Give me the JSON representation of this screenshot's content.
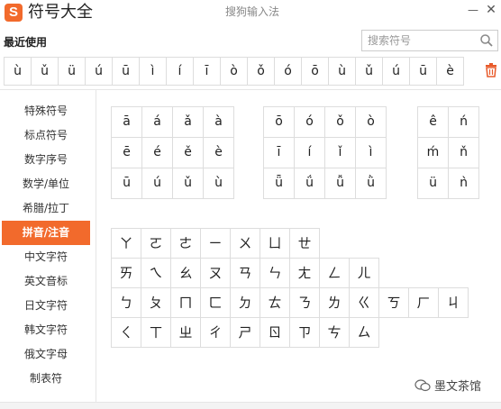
{
  "app": {
    "logo_letter": "S",
    "title": "符号大全",
    "window_title": "搜狗输入法",
    "minimize_glyph": "—",
    "close_glyph": "✕",
    "accent_color": "#f26a2c"
  },
  "recent": {
    "label": "最近使用",
    "search_placeholder": "搜索符号",
    "items": [
      "ù",
      "ǔ",
      "ü",
      "ú",
      "ū",
      "ì",
      "í",
      "ī",
      "ò",
      "ǒ",
      "ó",
      "ō",
      "ù",
      "ǔ",
      "ú",
      "ū",
      "è"
    ]
  },
  "sidebar": {
    "items": [
      "特殊符号",
      "标点符号",
      "数字序号",
      "数学/单位",
      "希腊/拉丁",
      "拼音/注音",
      "中文字符",
      "英文音标",
      "日文字符",
      "韩文字符",
      "俄文字母",
      "制表符"
    ],
    "active_index": 5
  },
  "pinyin": {
    "group_a": [
      "ā",
      "á",
      "ǎ",
      "à",
      "ē",
      "é",
      "ě",
      "è",
      "ū",
      "ú",
      "ǔ",
      "ù"
    ],
    "group_o": [
      "ō",
      "ó",
      "ǒ",
      "ò",
      "ī",
      "í",
      "ǐ",
      "ì",
      "ǖ",
      "ǘ",
      "ǚ",
      "ǜ"
    ],
    "group_e": [
      "ê",
      "ń",
      "ḿ",
      "ň",
      "ü",
      "ǹ"
    ]
  },
  "bopomofo": {
    "rows": [
      [
        "ㄚ",
        "ㄛ",
        "ㄜ",
        "ㄧ",
        "ㄨ",
        "ㄩ",
        "ㄝ"
      ],
      [
        "ㄞ",
        "ㄟ",
        "ㄠ",
        "ㄡ",
        "ㄢ",
        "ㄣ",
        "ㄤ",
        "ㄥ",
        "ㄦ"
      ],
      [
        "ㄅ",
        "ㄆ",
        "ㄇ",
        "ㄈ",
        "ㄉ",
        "ㄊ",
        "ㄋ",
        "ㄌ",
        "ㄍ",
        "ㄎ",
        "ㄏ",
        "ㄐ"
      ],
      [
        "ㄑ",
        "ㄒ",
        "ㄓ",
        "ㄔ",
        "ㄕ",
        "ㄖ",
        "ㄗ",
        "ㄘ",
        "ㄙ"
      ]
    ]
  },
  "watermark": {
    "text": "墨文茶馆"
  }
}
